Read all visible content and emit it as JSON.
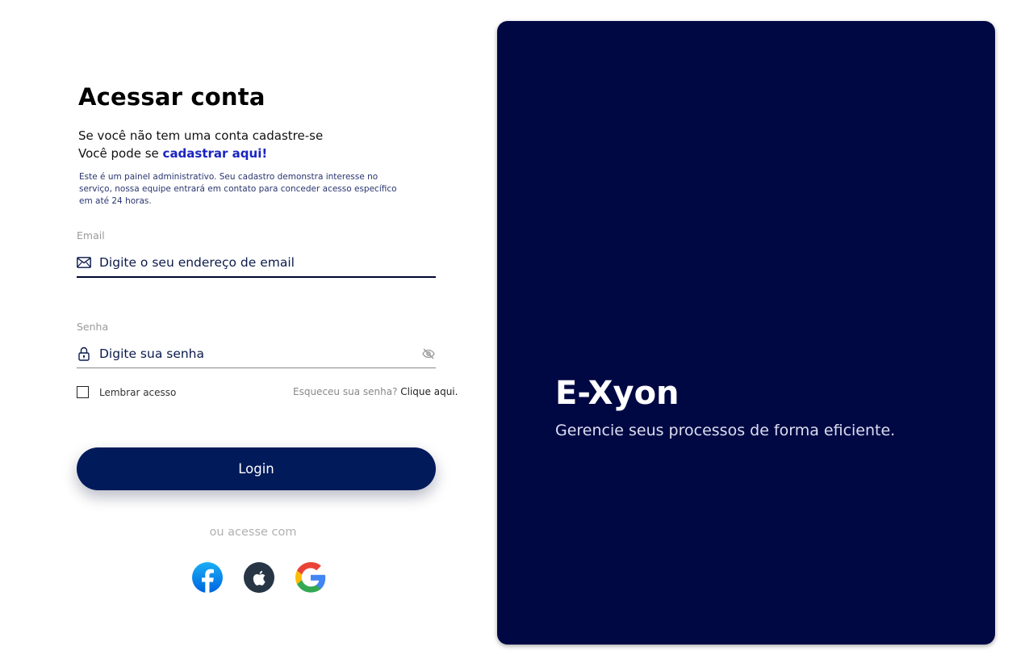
{
  "login": {
    "title": "Acessar conta",
    "subtitle_line1": "Se você não tem uma conta cadastre-se",
    "subtitle_line2_prefix": "Você pode se ",
    "register_link": "cadastrar aqui!",
    "notice": "Este é um painel administrativo. Seu cadastro demonstra interesse no serviço, nossa equipe entrará em contato para conceder acesso específico em até 24 horas.",
    "email": {
      "label": "Email",
      "placeholder": "Digite o seu endereço de email",
      "value": "",
      "icon": "envelope-icon"
    },
    "password": {
      "label": "Senha",
      "placeholder": "Digite sua senha",
      "value": "",
      "icon": "lock-icon",
      "toggle_icon": "eye-off-icon"
    },
    "remember_label": "Lembrar acesso",
    "remember_checked": false,
    "forgot_prefix": "Esqueceu sua senha? ",
    "forgot_link": "Clique aqui.",
    "login_button": "Login",
    "alt_label": "ou acesse com",
    "social": [
      {
        "name": "facebook",
        "icon": "facebook-icon",
        "color": "#1877f2"
      },
      {
        "name": "apple",
        "icon": "apple-icon",
        "color": "#283544"
      },
      {
        "name": "google",
        "icon": "google-icon"
      }
    ]
  },
  "panel": {
    "brand": "E-Xyon",
    "tagline": "Gerencie seus processos de forma eficiente.",
    "background": "#000844"
  },
  "colors": {
    "primary_button": "#001a5a",
    "link": "#1b24c2",
    "field_active_border": "#00062f"
  }
}
